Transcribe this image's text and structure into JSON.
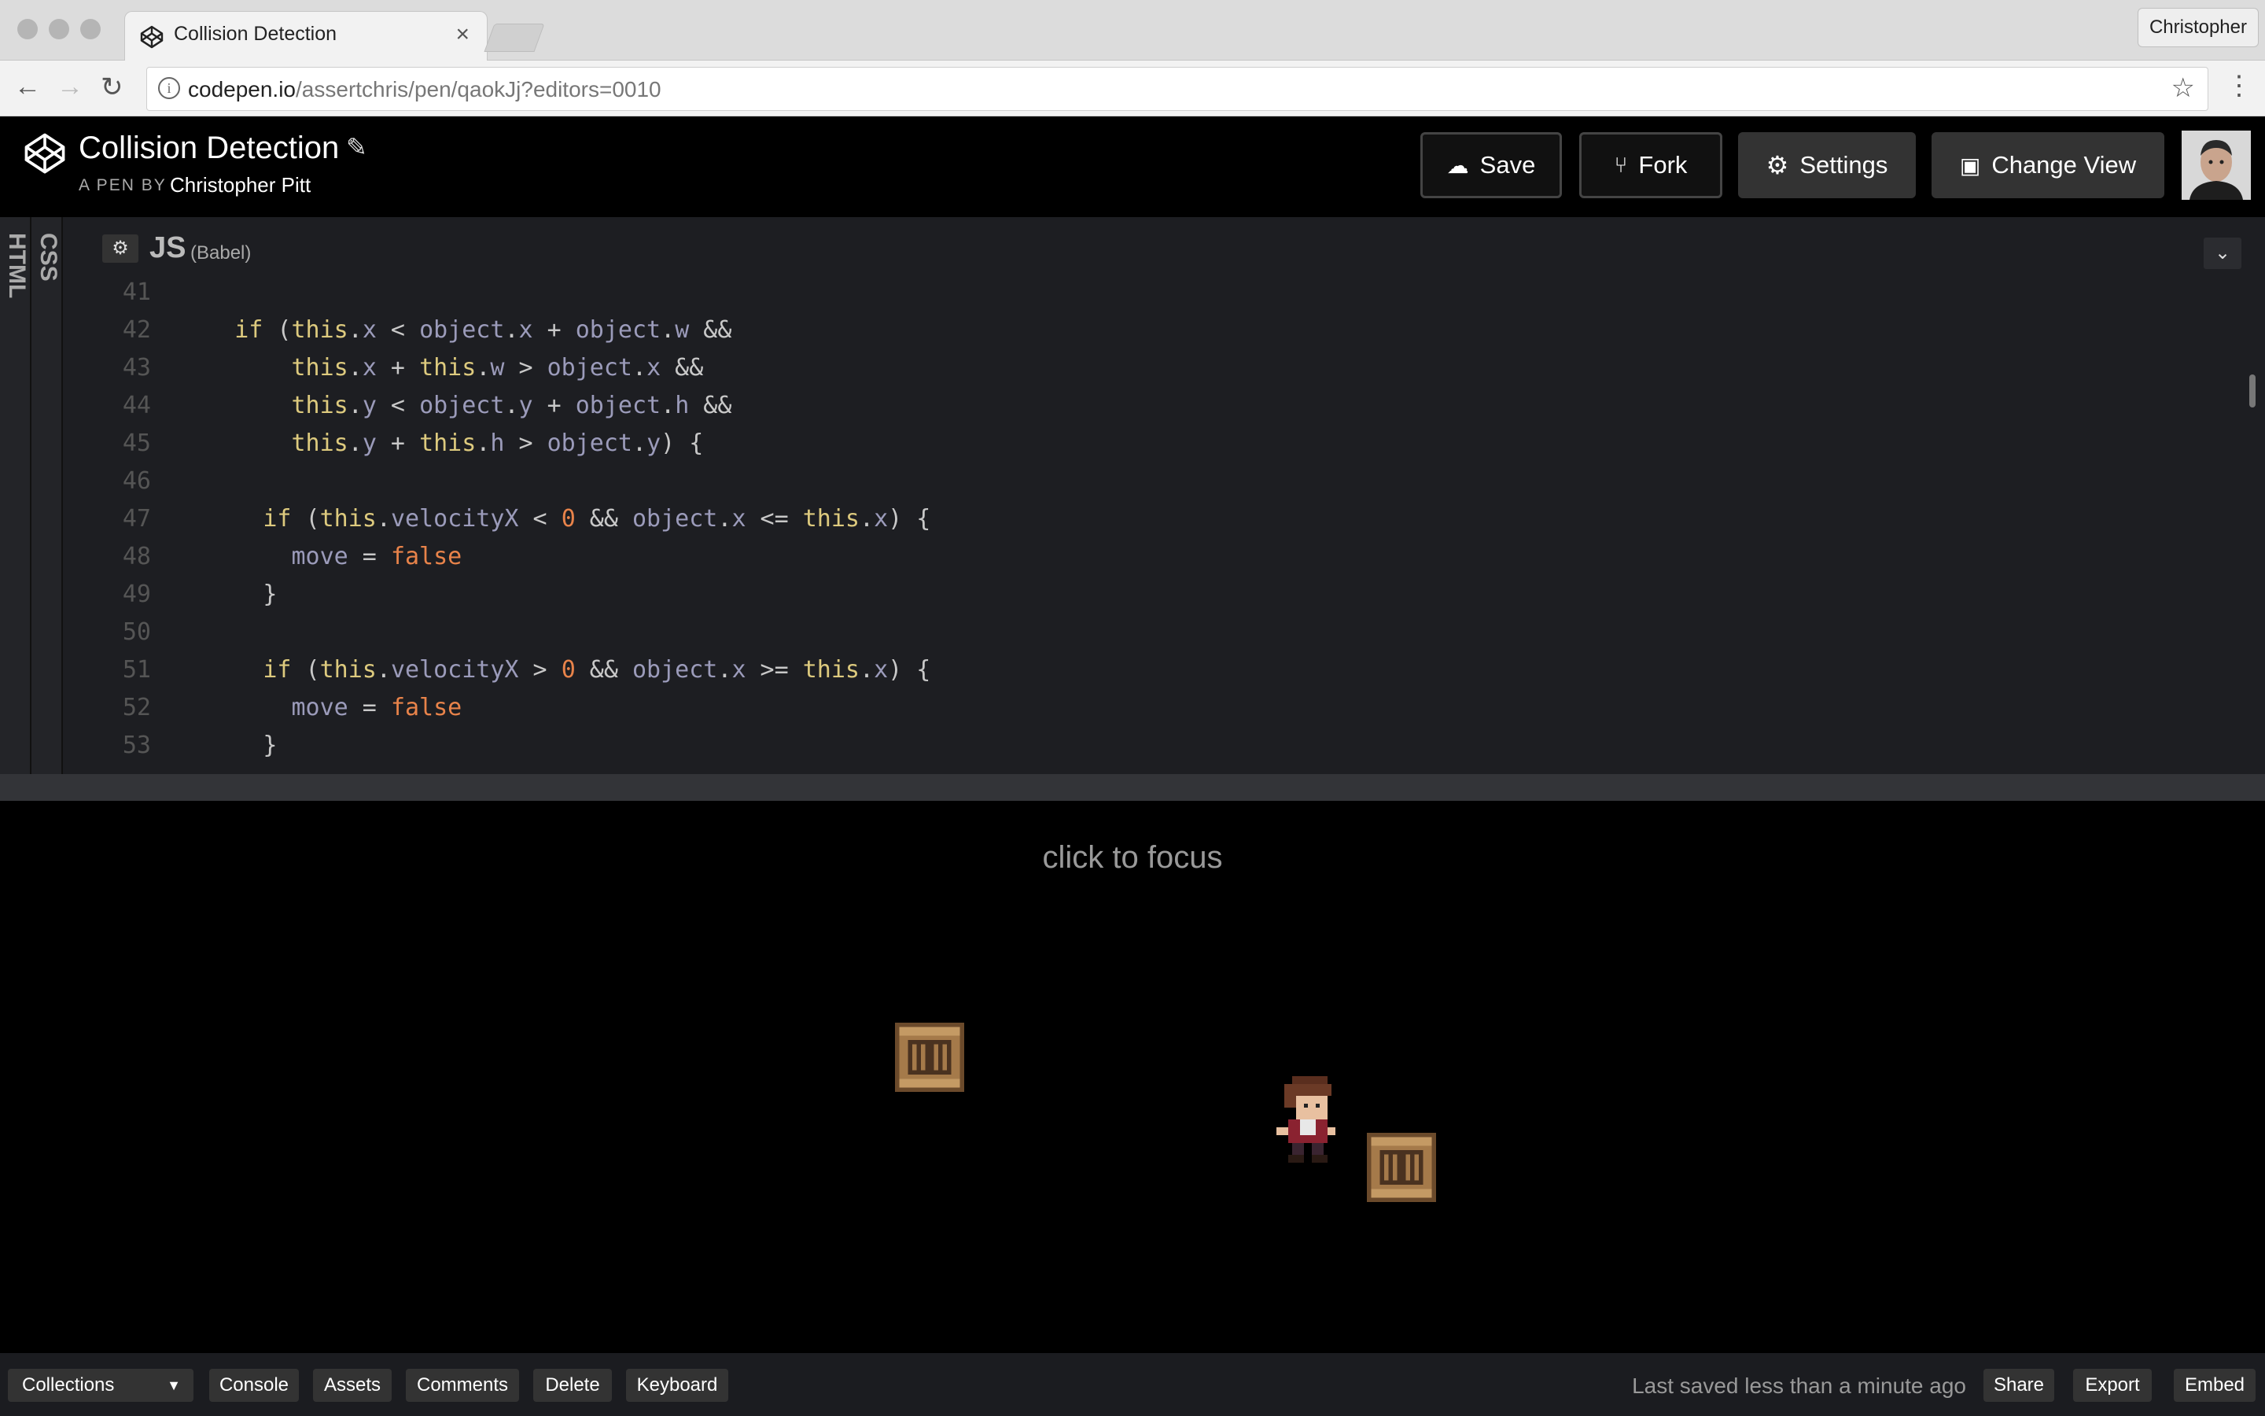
{
  "browser": {
    "tab_title": "Collision Detection",
    "url_host": "codepen.io",
    "url_path": "/assertchris/pen/qaokJj?editors=0010",
    "profile_name": "Christopher"
  },
  "header": {
    "pen_title": "Collision Detection",
    "by_label": "A PEN BY",
    "author": "Christopher Pitt",
    "save_label": "Save",
    "fork_label": "Fork",
    "settings_label": "Settings",
    "change_view_label": "Change View"
  },
  "editor": {
    "side_tabs": [
      "HTML",
      "CSS"
    ],
    "lang_label": "JS",
    "preprocessor": "(Babel)",
    "lines": [
      {
        "n": "41"
      },
      {
        "n": "42"
      },
      {
        "n": "43"
      },
      {
        "n": "44"
      },
      {
        "n": "45"
      },
      {
        "n": "46"
      },
      {
        "n": "47"
      },
      {
        "n": "48"
      },
      {
        "n": "49"
      },
      {
        "n": "50"
      },
      {
        "n": "51"
      },
      {
        "n": "52"
      },
      {
        "n": "53"
      }
    ]
  },
  "preview": {
    "focus_text": "click to focus"
  },
  "footer": {
    "collections_label": "Collections",
    "console_label": "Console",
    "assets_label": "Assets",
    "comments_label": "Comments",
    "delete_label": "Delete",
    "keyboard_label": "Keyboard",
    "saved_status": "Last saved less than a minute ago",
    "share_label": "Share",
    "export_label": "Export",
    "embed_label": "Embed"
  }
}
